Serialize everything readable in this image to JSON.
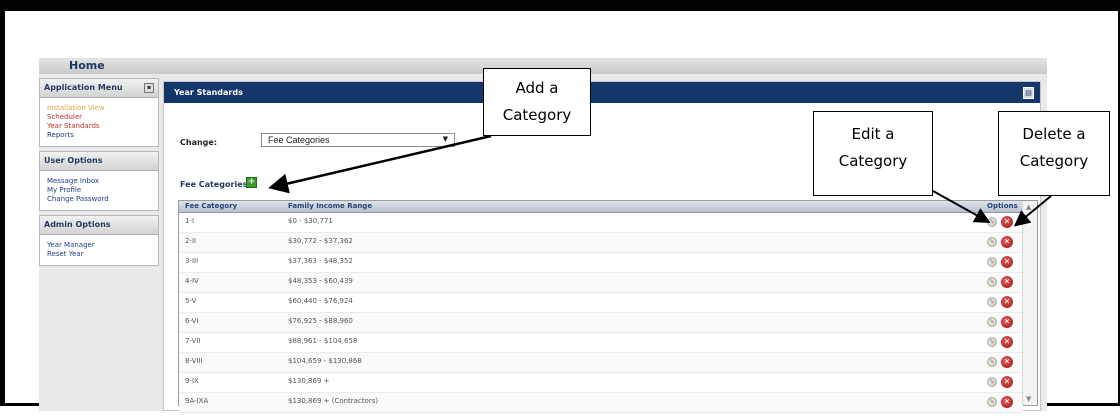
{
  "topbar": {
    "home_label": "Home"
  },
  "sidebar": {
    "application_menu": {
      "title": "Application Menu",
      "items": [
        {
          "label": "Installation View",
          "color": "#e8a33b"
        },
        {
          "label": "Scheduler",
          "color": "#c0332a"
        },
        {
          "label": "Year Standards",
          "color": "#c0332a"
        },
        {
          "label": "Reports",
          "color": "#1f3f8a"
        }
      ]
    },
    "user_options": {
      "title": "User Options",
      "items": [
        {
          "label": "Message Inbox"
        },
        {
          "label": "My Profile"
        },
        {
          "label": "Change Password"
        }
      ]
    },
    "admin_options": {
      "title": "Admin Options",
      "items": [
        {
          "label": "Year Manager"
        },
        {
          "label": "Reset Year"
        }
      ]
    }
  },
  "main": {
    "title": "Year Standards",
    "change_label": "Change:",
    "change_select_value": "Fee Categories",
    "fee_categories_label": "Fee Categories:",
    "table": {
      "headers": [
        "Fee Category",
        "Family Income Range",
        "Options"
      ],
      "rows": [
        [
          "1-I",
          "$0 - $30,771"
        ],
        [
          "2-II",
          "$30,772 - $37,362"
        ],
        [
          "3-III",
          "$37,363 - $48,352"
        ],
        [
          "4-IV",
          "$48,353 - $60,439"
        ],
        [
          "5-V",
          "$60,440 - $76,924"
        ],
        [
          "6-VI",
          "$76,925 - $88,960"
        ],
        [
          "7-VII",
          "$88,961 - $104,658"
        ],
        [
          "8-VIII",
          "$104,659 - $130,868"
        ],
        [
          "9-IX",
          "$130,869 +"
        ],
        [
          "9A-IXA",
          "$130,869 + (Contractors)"
        ]
      ]
    }
  },
  "callouts": {
    "add": [
      "Add a",
      "Category"
    ],
    "edit": [
      "Edit a",
      "Category"
    ],
    "delete": [
      "Delete a",
      "Category"
    ]
  },
  "colors": {
    "header_blue": "#14376b",
    "delete_red": "#b81c1c",
    "add_green": "#3a9a2a"
  }
}
